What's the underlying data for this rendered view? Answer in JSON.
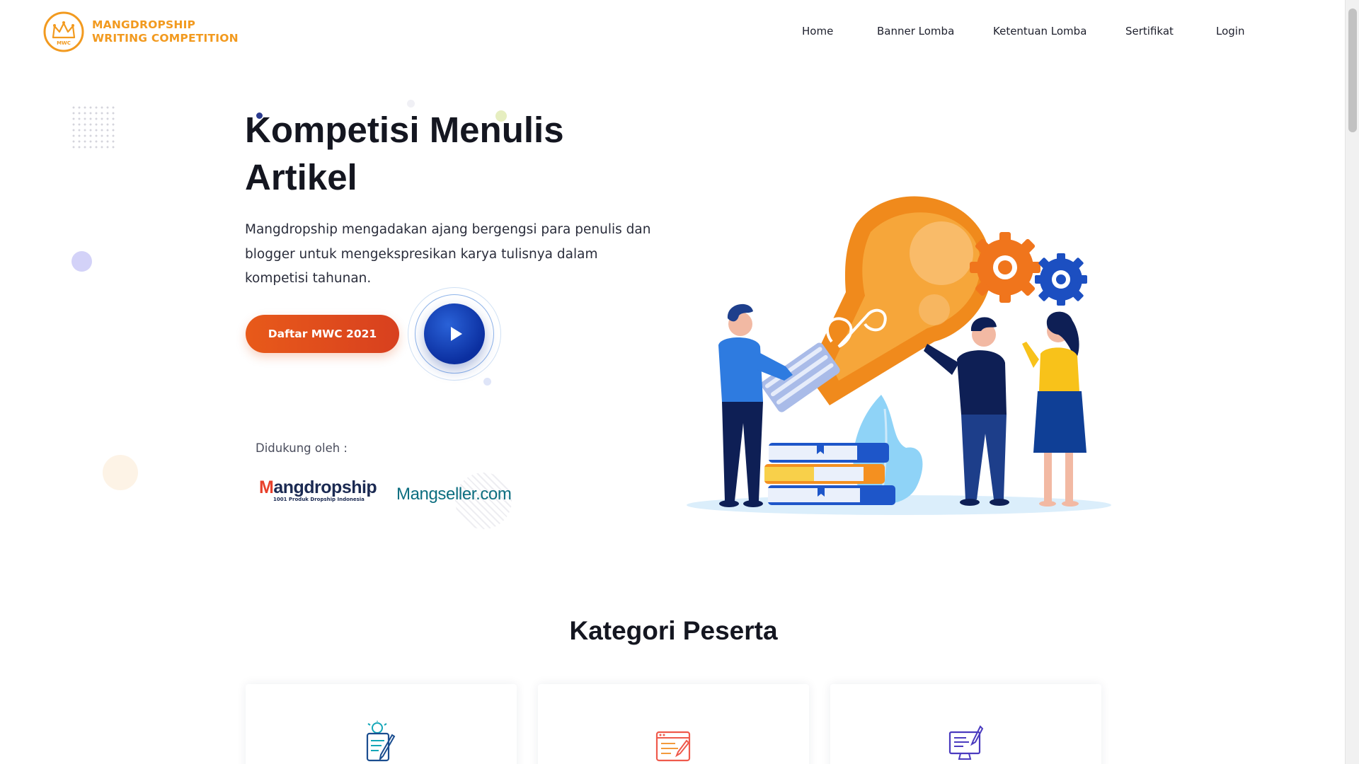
{
  "brand": {
    "line1": "MANGDROPSHIP",
    "line2": "WRITING COMPETITION",
    "badge_text": "MWC",
    "color": "#f29a1f"
  },
  "nav": {
    "items": [
      {
        "label": "Home"
      },
      {
        "label": "Banner Lomba"
      },
      {
        "label": "Ketentuan Lomba"
      },
      {
        "label": "Sertifikat"
      },
      {
        "label": "Login"
      }
    ]
  },
  "hero": {
    "title": "Kompetisi Menulis Artikel",
    "description": "Mangdropship mengadakan ajang bergengsi para penulis dan blogger untuk mengekspresikan karya tulisnya dalam kompetisi tahunan.",
    "cta_label": "Daftar MWC 2021",
    "play_icon": "play-icon",
    "accent_color": "#e85a1a",
    "play_color": "#0b2fa0"
  },
  "supporters": {
    "label": "Didukung oleh :",
    "partners": [
      {
        "name_prefix": "M",
        "name_rest": "angdropship",
        "tagline": "1001 Produk Dropship Indonesia"
      },
      {
        "name": "Mangseller.com"
      }
    ]
  },
  "kategori": {
    "title": "Kategori Peserta",
    "cards": [
      {
        "icon": "writing-idea-icon"
      },
      {
        "icon": "article-edit-icon"
      },
      {
        "icon": "blog-monitor-icon"
      }
    ]
  }
}
